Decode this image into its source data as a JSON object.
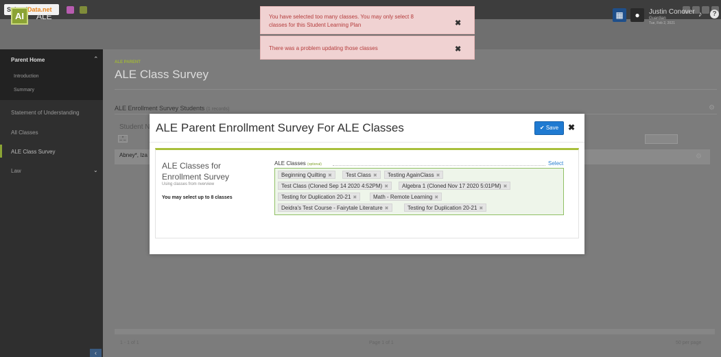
{
  "topbar": {
    "logo_part1": "School",
    "logo_part2": "Data.net",
    "colors": {
      "green": "#8ba335",
      "orange": "#e8841c",
      "blue": "#1f7ad1"
    }
  },
  "app": {
    "icon_text": "AI",
    "name": "ALE"
  },
  "user": {
    "name": "Justin Conover",
    "role": "Guardian",
    "date": "Tue, Feb 2, 2021"
  },
  "sidebar": {
    "group_title": "Parent Home",
    "sub_items": [
      "Introduction",
      "Summary"
    ],
    "items": [
      "Statement of Understanding",
      "All Classes",
      "ALE Class Survey",
      "Law"
    ]
  },
  "page": {
    "crumb": "ALE PARENT",
    "title": "ALE Class Survey",
    "section_title": "ALE Enrollment Survey Students",
    "section_count": "(1 records)",
    "grid_header_partial": "Student N",
    "filter_text": "_*_",
    "row_partial": "Abney*, Iza",
    "pager_left": "1 - 1 of 1",
    "pager_mid": "Page 1 of 1",
    "pager_right": "50 per page"
  },
  "toasts": [
    {
      "line1": "You have selected too many classes. You may only select 8",
      "line2": "classes for this Student Learning Plan",
      "close": "✖"
    },
    {
      "line1": "There was a problem updating those classes",
      "close": "✖"
    }
  ],
  "modal": {
    "title": "ALE Parent Enrollment Survey For ALE Classes",
    "save_label": "Save",
    "close": "✖",
    "card_heading_1": "ALE Classes for",
    "card_heading_2": "Enrollment Survey",
    "card_sub": "Using classes from nverview",
    "card_note": "You may select up to 8 classes",
    "field_label": "ALE Classes",
    "field_optional": "(optional)",
    "select_link": "Select",
    "tags": [
      "Beginning Quilting",
      "Test Class",
      "Testing AgainClass",
      "Test Class (Cloned Sep 14 2020 4:52PM)",
      "Algebra 1 (Cloned Nov 17 2020 5:01PM)",
      "Testing for Duplication 20-21",
      "Math - Remote Learning",
      "Deidra's Test Course - Fairytale Literature",
      "Testing for Duplication 20-21"
    ],
    "tag_remove_glyph": "✖"
  }
}
